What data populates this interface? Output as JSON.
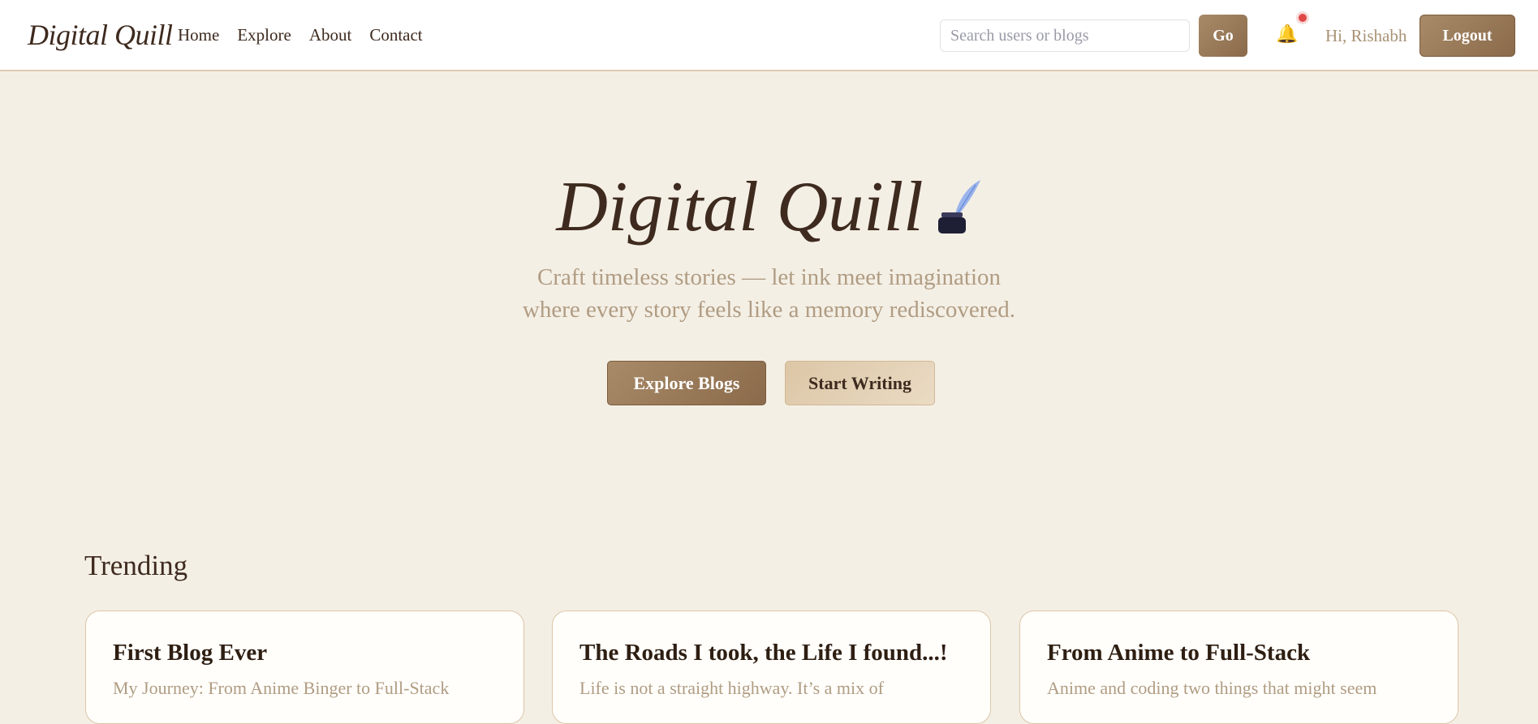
{
  "nav": {
    "logo": "Digital Quill",
    "links": [
      "Home",
      "Explore",
      "About",
      "Contact"
    ],
    "search_placeholder": "Search users or blogs",
    "go": "Go",
    "greeting": "Hi, Rishabh",
    "logout": "Logout"
  },
  "hero": {
    "title": "Digital Quill",
    "subtitle_1": "Craft timeless stories — let ink meet imagination",
    "subtitle_2": "where every story feels like a memory rediscovered.",
    "explore": "Explore Blogs",
    "write": "Start Writing"
  },
  "trending": {
    "heading": "Trending",
    "cards": [
      {
        "title": "First Blog Ever",
        "excerpt": "My Journey: From Anime Binger to Full-Stack"
      },
      {
        "title": "The Roads I took, the Life I found...!",
        "excerpt": "Life is not a straight highway. It’s a mix of"
      },
      {
        "title": "From Anime to Full-Stack",
        "excerpt": "Anime and coding two things that might seem"
      }
    ]
  }
}
